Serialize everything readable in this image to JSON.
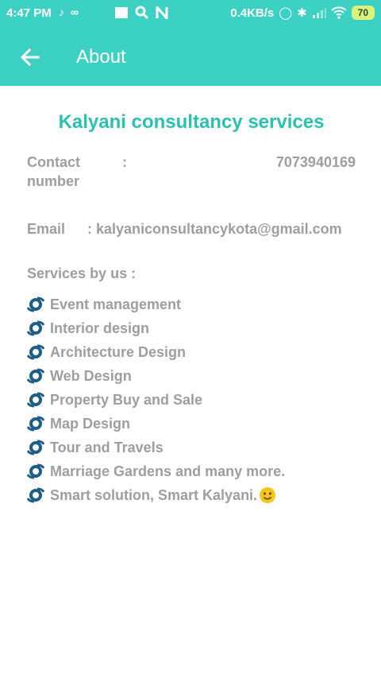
{
  "status_bar": {
    "time": "4:47 PM",
    "network_speed": "0.4KB/s",
    "battery": "70"
  },
  "appbar": {
    "title": "About",
    "back_icon": "arrow-left-icon"
  },
  "company": {
    "name": "Kalyani consultancy services"
  },
  "contact": {
    "label": "Contact number",
    "separator": ":",
    "value": "7073940169"
  },
  "email": {
    "label": "Email",
    "value": ": kalyaniconsultancykota@gmail.com"
  },
  "services": {
    "heading": "Services by us :",
    "items": [
      "Event management",
      "Interior design",
      "Architecture Design",
      "Web Design",
      "Property Buy and Sale",
      "Map Design",
      "Tour and Travels",
      "Marriage Gardens and many more.",
      "Smart solution, Smart Kalyani."
    ]
  },
  "colors": {
    "accent": "#3cd1c2",
    "title_text": "#2ac0b2",
    "body_text": "#9e9e9e",
    "bullet": "#1f5f86"
  }
}
